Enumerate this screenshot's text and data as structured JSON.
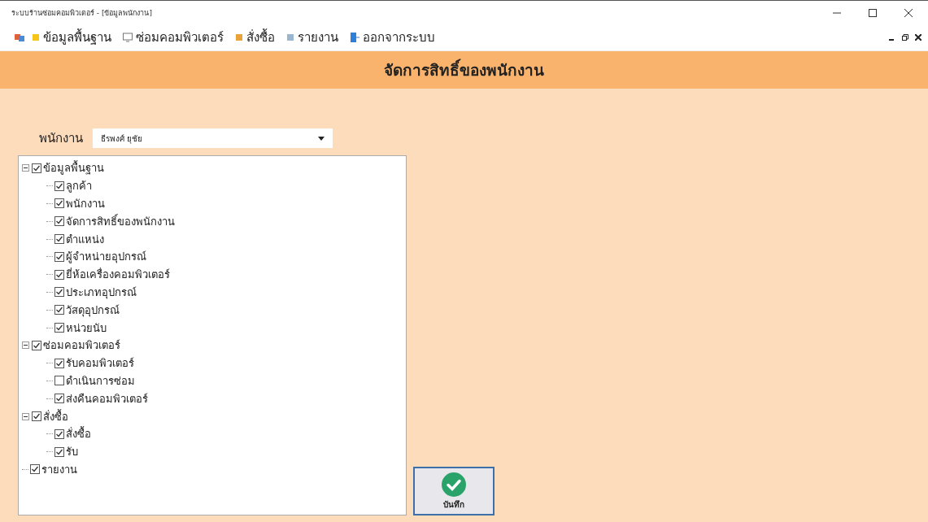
{
  "window": {
    "title": "ระบบร้านซ่อมคอมพิวเตอร์ - [ข้อมูลพนักงาน]"
  },
  "menu": [
    {
      "label": "ข้อมูลพื้นฐาน",
      "kind": "data"
    },
    {
      "label": "ซ่อมคอมพิวเตอร์",
      "kind": "monitor"
    },
    {
      "label": "สั่งซื้อ",
      "kind": "order"
    },
    {
      "label": "รายงาน",
      "kind": "report"
    },
    {
      "label": "ออกจากระบบ",
      "kind": "exit"
    }
  ],
  "header": {
    "title": "จัดการสิทธิ์ของพนักงาน"
  },
  "employee": {
    "label": "พนักงาน",
    "value": "ธีรพงศ์ ยุชัย"
  },
  "tree": [
    {
      "label": "ข้อมูลพื้นฐาน",
      "checked": true,
      "expanded": true,
      "children": [
        {
          "label": "ลูกค้า",
          "checked": true
        },
        {
          "label": "พนักงาน",
          "checked": true
        },
        {
          "label": "จัดการสิทธิ์ของพนักงาน",
          "checked": true
        },
        {
          "label": "ตำแหน่ง",
          "checked": true
        },
        {
          "label": "ผู้จำหน่ายอุปกรณ์",
          "checked": true
        },
        {
          "label": "ยี่ห้อเครื่องคอมพิวเตอร์",
          "checked": true
        },
        {
          "label": "ประเภทอุปกรณ์",
          "checked": true
        },
        {
          "label": "วัสดุอุปกรณ์",
          "checked": true
        },
        {
          "label": "หน่วยนับ",
          "checked": true
        }
      ]
    },
    {
      "label": "ซ่อมคอมพิวเตอร์",
      "checked": true,
      "expanded": true,
      "children": [
        {
          "label": "รับคอมพิวเตอร์",
          "checked": true
        },
        {
          "label": "ดำเนินการซ่อม",
          "checked": false
        },
        {
          "label": "ส่งคืนคอมพิวเตอร์",
          "checked": true
        }
      ]
    },
    {
      "label": "สั่งซื้อ",
      "checked": true,
      "expanded": true,
      "children": [
        {
          "label": "สั่งซื้อ",
          "checked": true
        },
        {
          "label": "รับ",
          "checked": true
        }
      ]
    },
    {
      "label": "รายงาน",
      "checked": true
    }
  ],
  "save_button": {
    "label": "บันทึก"
  }
}
